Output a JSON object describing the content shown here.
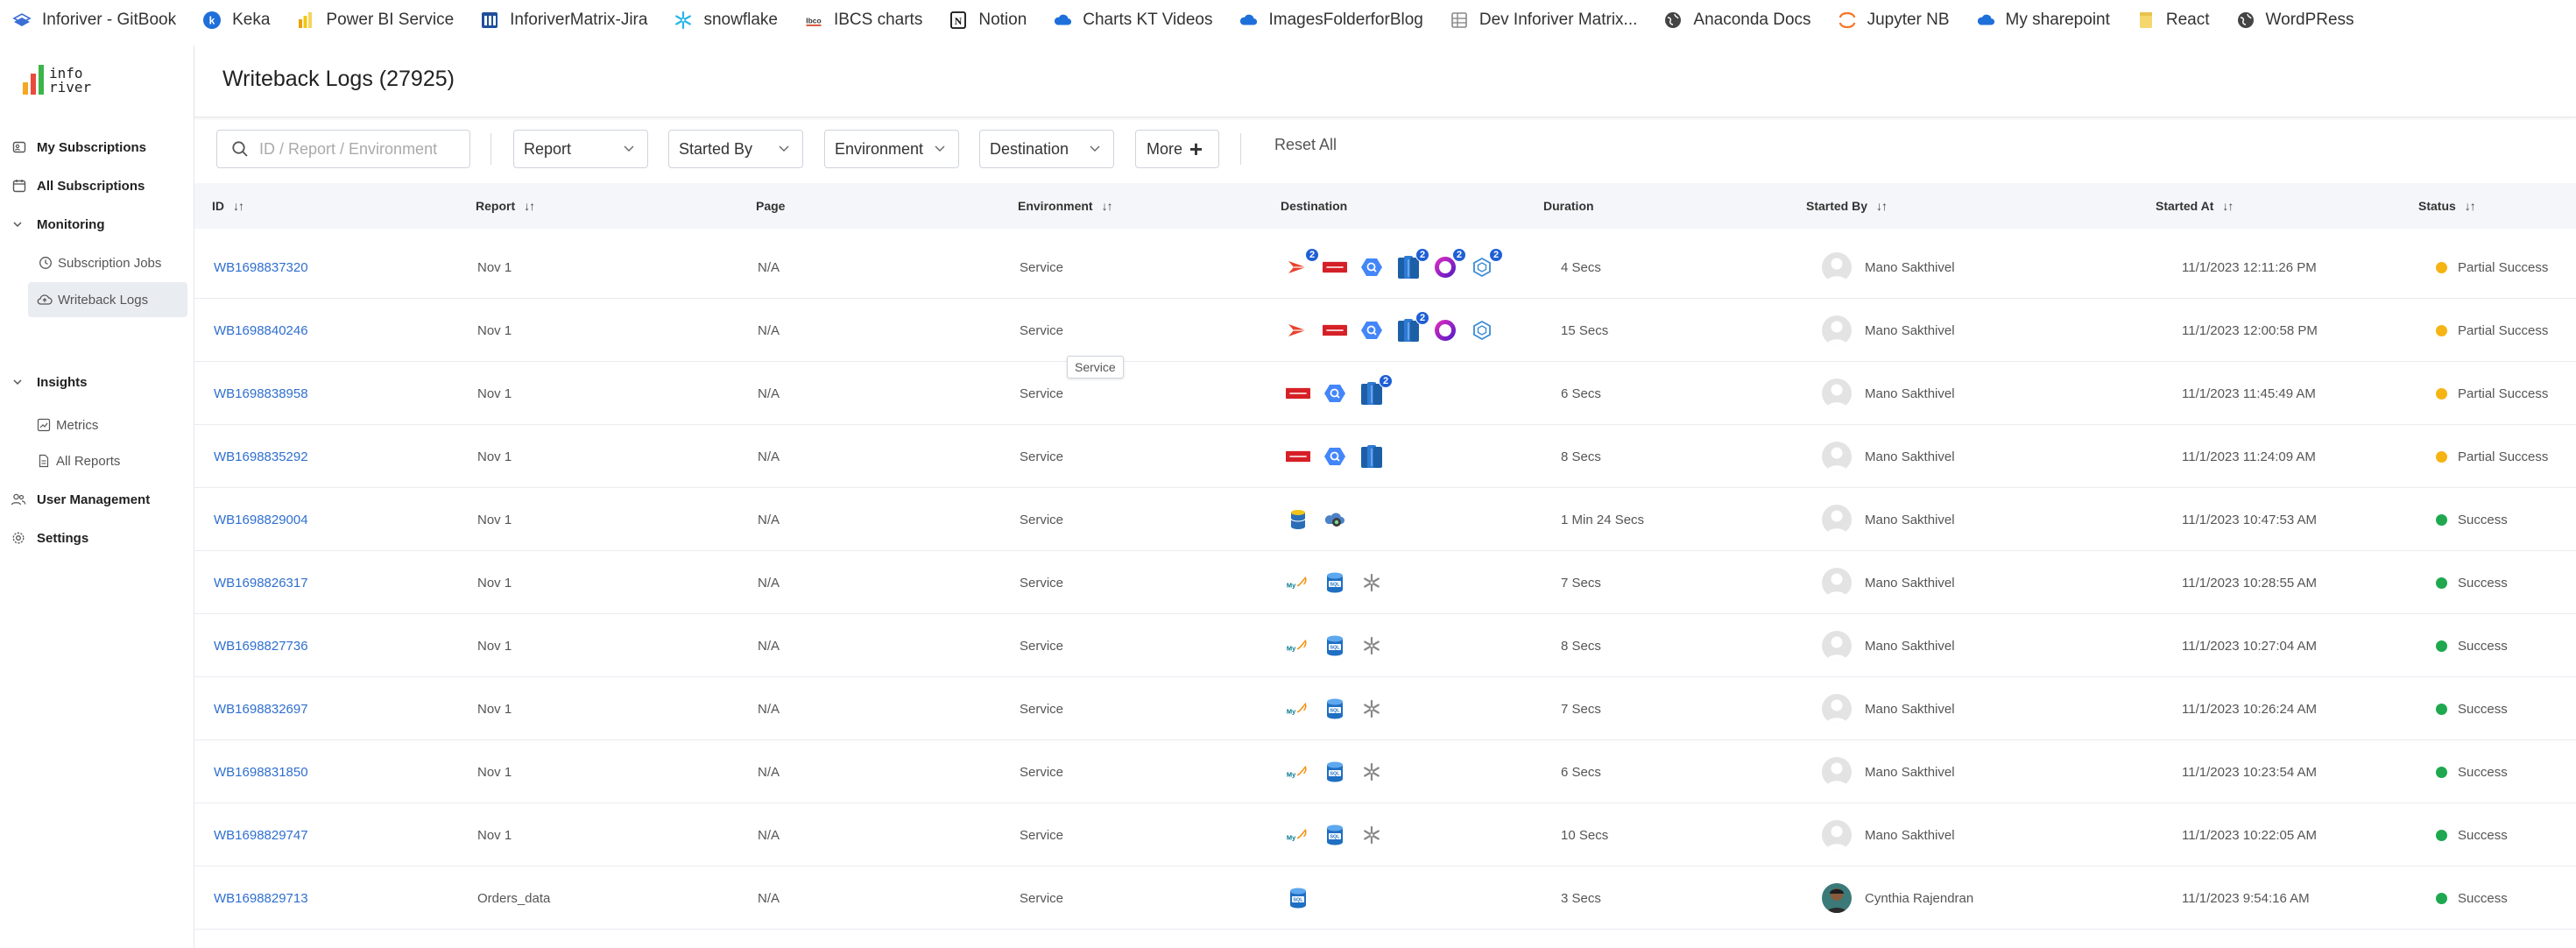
{
  "bookmarks": [
    {
      "label": "Inforiver - GitBook",
      "icon": "gitbook-icon",
      "color": "#3b6ed6"
    },
    {
      "label": "Keka",
      "icon": "keka-icon",
      "color": "#1e6fd9"
    },
    {
      "label": "Power BI Service",
      "icon": "powerbi-icon",
      "color": "#f2c811"
    },
    {
      "label": "InforiverMatrix-Jira",
      "icon": "jira-icon",
      "color": "#1f4f9c"
    },
    {
      "label": "snowflake",
      "icon": "snowflake-icon",
      "color": "#29b5e8"
    },
    {
      "label": "IBCS charts",
      "icon": "ibcs-icon",
      "color": "#555555"
    },
    {
      "label": "Notion",
      "icon": "notion-icon",
      "color": "#111111"
    },
    {
      "label": "Charts KT Videos",
      "icon": "onedrive-icon",
      "color": "#1e6fd9"
    },
    {
      "label": "ImagesFolderforBlog",
      "icon": "onedrive-icon",
      "color": "#1e6fd9"
    },
    {
      "label": "Dev Inforiver Matrix...",
      "icon": "grid-icon",
      "color": "#888888"
    },
    {
      "label": "Anaconda Docs",
      "icon": "globe-icon",
      "color": "#444444"
    },
    {
      "label": "Jupyter NB",
      "icon": "jupyter-icon",
      "color": "#f37626"
    },
    {
      "label": "My sharepoint",
      "icon": "onedrive-icon",
      "color": "#1e6fd9"
    },
    {
      "label": "React",
      "icon": "folder-icon",
      "color": "#f5d76e"
    },
    {
      "label": "WordPRess",
      "icon": "globe-icon",
      "color": "#444444"
    }
  ],
  "logo": {
    "line1": "info",
    "line2": "river"
  },
  "sidebar": {
    "my_subscriptions": "My Subscriptions",
    "all_subscriptions": "All Subscriptions",
    "monitoring": "Monitoring",
    "subscription_jobs": "Subscription Jobs",
    "writeback_logs": "Writeback Logs",
    "insights": "Insights",
    "metrics": "Metrics",
    "all_reports": "All Reports",
    "user_management": "User Management",
    "settings": "Settings"
  },
  "header": {
    "title": "Writeback Logs (27925)"
  },
  "filters": {
    "search_placeholder": "ID / Report / Environment",
    "report": "Report",
    "started_by": "Started By",
    "environment": "Environment",
    "destination": "Destination",
    "more": "More",
    "reset_all": "Reset All"
  },
  "columns": {
    "id": "ID",
    "report": "Report",
    "page": "Page",
    "environment": "Environment",
    "destination": "Destination",
    "duration": "Duration",
    "started_by": "Started By",
    "started_at": "Started At",
    "status": "Status"
  },
  "tooltip": "Service",
  "status_colors": {
    "Partial Success": "#f5b414",
    "Success": "#1fa84f"
  },
  "rows": [
    {
      "id": "WB1698837320",
      "report": "Nov 1",
      "page": "N/A",
      "environment": "Service",
      "destinations": [
        {
          "icon": "powerapps-icon",
          "badge": "2"
        },
        {
          "icon": "oracle-icon",
          "badge": ""
        },
        {
          "icon": "bigquery-icon",
          "badge": ""
        },
        {
          "icon": "azure-sql-icon",
          "badge": "2"
        },
        {
          "icon": "ring-icon",
          "badge": "2"
        },
        {
          "icon": "hexagon-icon",
          "badge": "2"
        }
      ],
      "duration": "4 Secs",
      "started_by": "Mano Sakthivel",
      "avatar": "generic",
      "started_at": "11/1/2023 12:11:26 PM",
      "status": "Partial Success"
    },
    {
      "id": "WB1698840246",
      "report": "Nov 1",
      "page": "N/A",
      "environment": "Service",
      "destinations": [
        {
          "icon": "powerapps-icon",
          "badge": ""
        },
        {
          "icon": "oracle-icon",
          "badge": ""
        },
        {
          "icon": "bigquery-icon",
          "badge": ""
        },
        {
          "icon": "azure-sql-icon",
          "badge": "2"
        },
        {
          "icon": "ring-icon",
          "badge": ""
        },
        {
          "icon": "hexagon-icon",
          "badge": ""
        }
      ],
      "duration": "15 Secs",
      "started_by": "Mano Sakthivel",
      "avatar": "generic",
      "started_at": "11/1/2023 12:00:58 PM",
      "status": "Partial Success"
    },
    {
      "id": "WB1698838958",
      "report": "Nov 1",
      "page": "N/A",
      "environment": "Service",
      "destinations": [
        {
          "icon": "oracle-icon",
          "badge": ""
        },
        {
          "icon": "bigquery-icon",
          "badge": ""
        },
        {
          "icon": "azure-sql-icon",
          "badge": "2"
        }
      ],
      "duration": "6 Secs",
      "started_by": "Mano Sakthivel",
      "avatar": "generic",
      "started_at": "11/1/2023 11:45:49 AM",
      "status": "Partial Success"
    },
    {
      "id": "WB1698835292",
      "report": "Nov 1",
      "page": "N/A",
      "environment": "Service",
      "destinations": [
        {
          "icon": "oracle-icon",
          "badge": ""
        },
        {
          "icon": "bigquery-icon",
          "badge": ""
        },
        {
          "icon": "azure-sql-icon",
          "badge": ""
        }
      ],
      "duration": "8 Secs",
      "started_by": "Mano Sakthivel",
      "avatar": "generic",
      "started_at": "11/1/2023 11:24:09 AM",
      "status": "Partial Success"
    },
    {
      "id": "WB1698829004",
      "report": "Nov 1",
      "page": "N/A",
      "environment": "Service",
      "destinations": [
        {
          "icon": "database-icon",
          "badge": ""
        },
        {
          "icon": "datalake-icon",
          "badge": ""
        }
      ],
      "duration": "1 Min 24 Secs",
      "started_by": "Mano Sakthivel",
      "avatar": "generic",
      "started_at": "11/1/2023 10:47:53 AM",
      "status": "Success"
    },
    {
      "id": "WB1698826317",
      "report": "Nov 1",
      "page": "N/A",
      "environment": "Service",
      "destinations": [
        {
          "icon": "mysql-icon",
          "badge": ""
        },
        {
          "icon": "sql-db-icon",
          "badge": ""
        },
        {
          "icon": "snowflake-icon",
          "badge": ""
        }
      ],
      "duration": "7 Secs",
      "started_by": "Mano Sakthivel",
      "avatar": "generic",
      "started_at": "11/1/2023 10:28:55 AM",
      "status": "Success"
    },
    {
      "id": "WB1698827736",
      "report": "Nov 1",
      "page": "N/A",
      "environment": "Service",
      "destinations": [
        {
          "icon": "mysql-icon",
          "badge": ""
        },
        {
          "icon": "sql-db-icon",
          "badge": ""
        },
        {
          "icon": "snowflake-icon",
          "badge": ""
        }
      ],
      "duration": "8 Secs",
      "started_by": "Mano Sakthivel",
      "avatar": "generic",
      "started_at": "11/1/2023 10:27:04 AM",
      "status": "Success"
    },
    {
      "id": "WB1698832697",
      "report": "Nov 1",
      "page": "N/A",
      "environment": "Service",
      "destinations": [
        {
          "icon": "mysql-icon",
          "badge": ""
        },
        {
          "icon": "sql-db-icon",
          "badge": ""
        },
        {
          "icon": "snowflake-icon",
          "badge": ""
        }
      ],
      "duration": "7 Secs",
      "started_by": "Mano Sakthivel",
      "avatar": "generic",
      "started_at": "11/1/2023 10:26:24 AM",
      "status": "Success"
    },
    {
      "id": "WB1698831850",
      "report": "Nov 1",
      "page": "N/A",
      "environment": "Service",
      "destinations": [
        {
          "icon": "mysql-icon",
          "badge": ""
        },
        {
          "icon": "sql-db-icon",
          "badge": ""
        },
        {
          "icon": "snowflake-icon",
          "badge": ""
        }
      ],
      "duration": "6 Secs",
      "started_by": "Mano Sakthivel",
      "avatar": "generic",
      "started_at": "11/1/2023 10:23:54 AM",
      "status": "Success"
    },
    {
      "id": "WB1698829747",
      "report": "Nov 1",
      "page": "N/A",
      "environment": "Service",
      "destinations": [
        {
          "icon": "mysql-icon",
          "badge": ""
        },
        {
          "icon": "sql-db-icon",
          "badge": ""
        },
        {
          "icon": "snowflake-icon",
          "badge": ""
        }
      ],
      "duration": "10 Secs",
      "started_by": "Mano Sakthivel",
      "avatar": "generic",
      "started_at": "11/1/2023 10:22:05 AM",
      "status": "Success"
    },
    {
      "id": "WB1698829713",
      "report": "Orders_data",
      "page": "N/A",
      "environment": "Service",
      "destinations": [
        {
          "icon": "sql-db-icon",
          "badge": ""
        }
      ],
      "duration": "3 Secs",
      "started_by": "Cynthia Rajendran",
      "avatar": "photo",
      "started_at": "11/1/2023 9:54:16 AM",
      "status": "Success"
    }
  ]
}
